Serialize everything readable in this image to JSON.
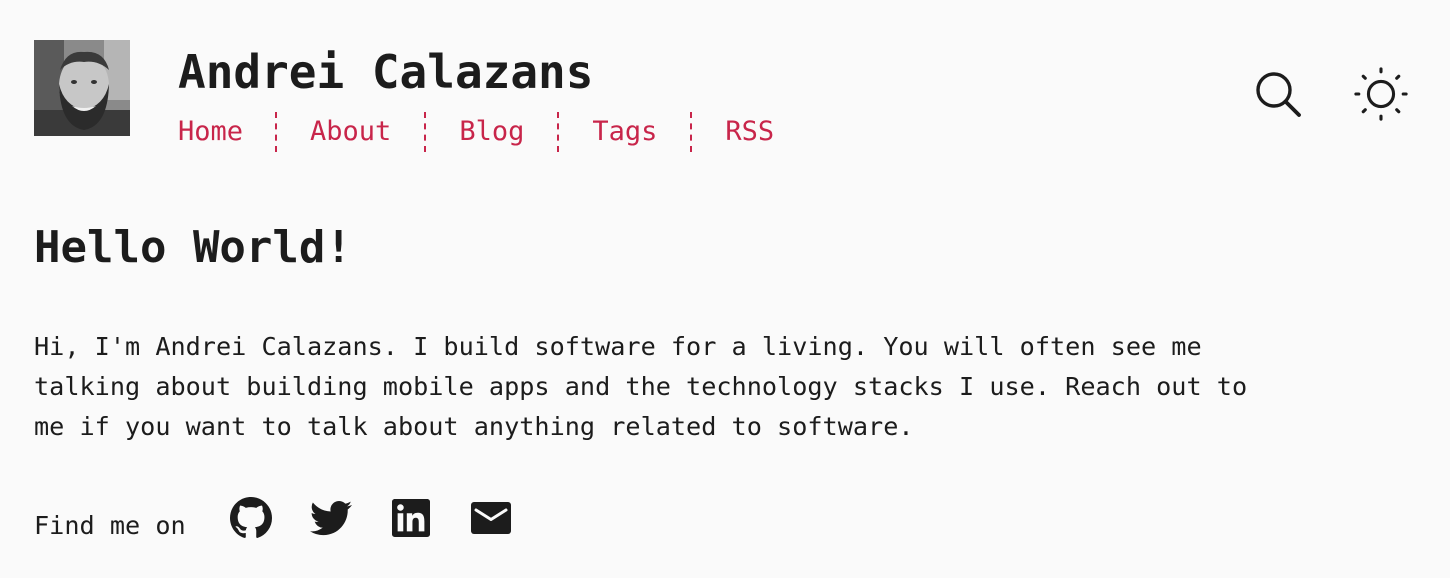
{
  "header": {
    "site_title": "Andrei Calazans",
    "avatar_alt": "avatar",
    "nav": [
      {
        "label": "Home"
      },
      {
        "label": "About"
      },
      {
        "label": "Blog"
      },
      {
        "label": "Tags"
      },
      {
        "label": "RSS"
      }
    ],
    "search_icon": "search-icon",
    "theme_icon": "sun-icon"
  },
  "main": {
    "title": "Hello World!",
    "intro": "Hi, I'm Andrei Calazans. I build software for a living. You will often see me\ntalking about building mobile apps and the technology stacks I use. Reach out to\nme if you want to talk about anything related to software.",
    "find_me_label": "Find me on",
    "social_links": [
      {
        "icon": "github-icon"
      },
      {
        "icon": "twitter-icon"
      },
      {
        "icon": "linkedin-icon"
      },
      {
        "icon": "mail-icon"
      }
    ]
  },
  "colors": {
    "accent": "#c8254a",
    "text": "#1c1c1c",
    "background": "#fafafa"
  }
}
